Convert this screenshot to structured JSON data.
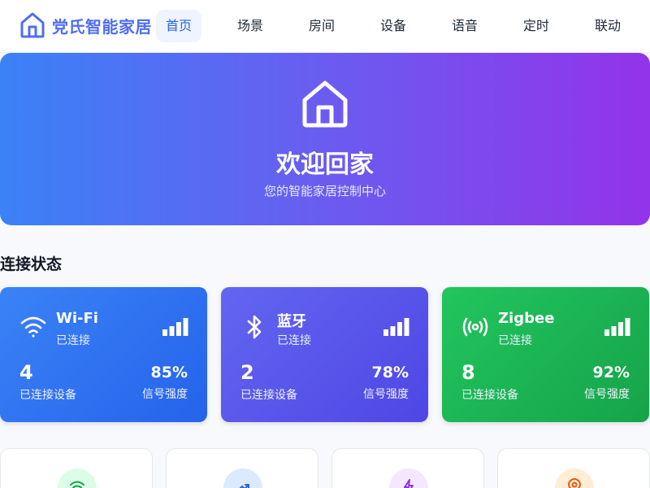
{
  "header": {
    "brand": "党氏智能家居",
    "brand_icon": "home-icon",
    "nav": [
      {
        "label": "首页",
        "active": true
      },
      {
        "label": "场景",
        "active": false
      },
      {
        "label": "房间",
        "active": false
      },
      {
        "label": "设备",
        "active": false
      },
      {
        "label": "语音",
        "active": false
      },
      {
        "label": "定时",
        "active": false
      },
      {
        "label": "联动",
        "active": false
      }
    ]
  },
  "hero": {
    "icon": "home-icon",
    "title": "欢迎回家",
    "subtitle": "您的智能家居控制中心"
  },
  "connection": {
    "title": "连接状态",
    "cards": [
      {
        "name": "Wi-Fi",
        "status": "已连接",
        "count": "4",
        "count_label": "已连接设备",
        "signal": "85%",
        "signal_label": "信号强度",
        "icon": "wifi-icon",
        "color": "#3b82f6"
      },
      {
        "name": "蓝牙",
        "status": "已连接",
        "count": "2",
        "count_label": "已连接设备",
        "signal": "78%",
        "signal_label": "信号强度",
        "icon": "bluetooth-icon",
        "color": "#6366f1"
      },
      {
        "name": "Zigbee",
        "status": "已连接",
        "count": "8",
        "count_label": "已连接设备",
        "signal": "92%",
        "signal_label": "信号强度",
        "icon": "zigbee-signal-icon",
        "color": "#22c55e"
      }
    ]
  },
  "features": [
    {
      "icon": "wifi-icon",
      "color": "#16a34a",
      "bg": "#dcfce7"
    },
    {
      "icon": "trend-arrow-icon",
      "color": "#2563eb",
      "bg": "#dbeafe"
    },
    {
      "icon": "lightning-icon",
      "color": "#9333ea",
      "bg": "#f3e8ff"
    },
    {
      "icon": "location-pin-icon",
      "color": "#ea580c",
      "bg": "#ffedd5"
    }
  ],
  "colors": {
    "brand": "#4f6df5",
    "nav_active": "#2563eb",
    "hero_gradient_start": "#3b82f6",
    "hero_gradient_end": "#9333ea"
  }
}
